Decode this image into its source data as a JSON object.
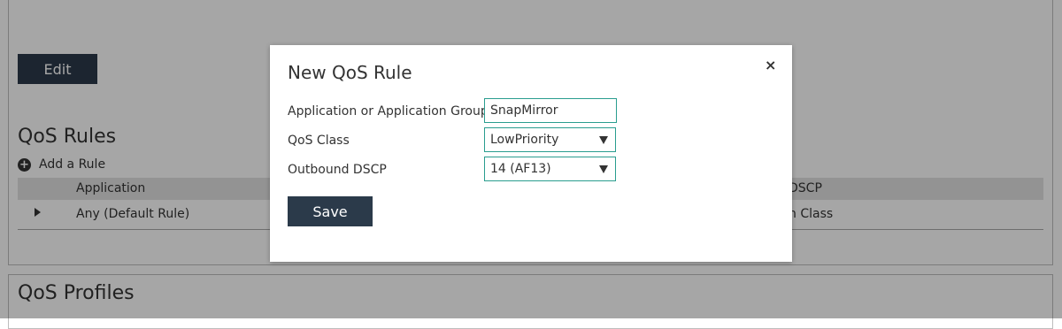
{
  "background_page": {
    "edit_button_label": "Edit",
    "qos_rules_title": "QoS Rules",
    "add_rule_label": "Add a Rule",
    "table": {
      "columns": [
        "Application",
        "DSCP"
      ],
      "rows": [
        {
          "application": "Any (Default Rule)",
          "dscp": "n Class"
        }
      ]
    },
    "qos_profiles_title": "QoS Profiles"
  },
  "modal": {
    "title": "New QoS Rule",
    "close_symbol": "×",
    "fields": {
      "application": {
        "label": "Application or Application Group",
        "value": "SnapMirror"
      },
      "qos_class": {
        "label": "QoS Class",
        "selected": "LowPriority"
      },
      "outbound_dscp": {
        "label": "Outbound DSCP",
        "selected": "14 (AF13)"
      }
    },
    "save_label": "Save"
  },
  "colors": {
    "button_bg": "#2b3a4a",
    "input_border": "#2a9d8f",
    "overlay": "rgba(0,0,0,0.35)",
    "table_header_bg": "#e2e2e2"
  }
}
